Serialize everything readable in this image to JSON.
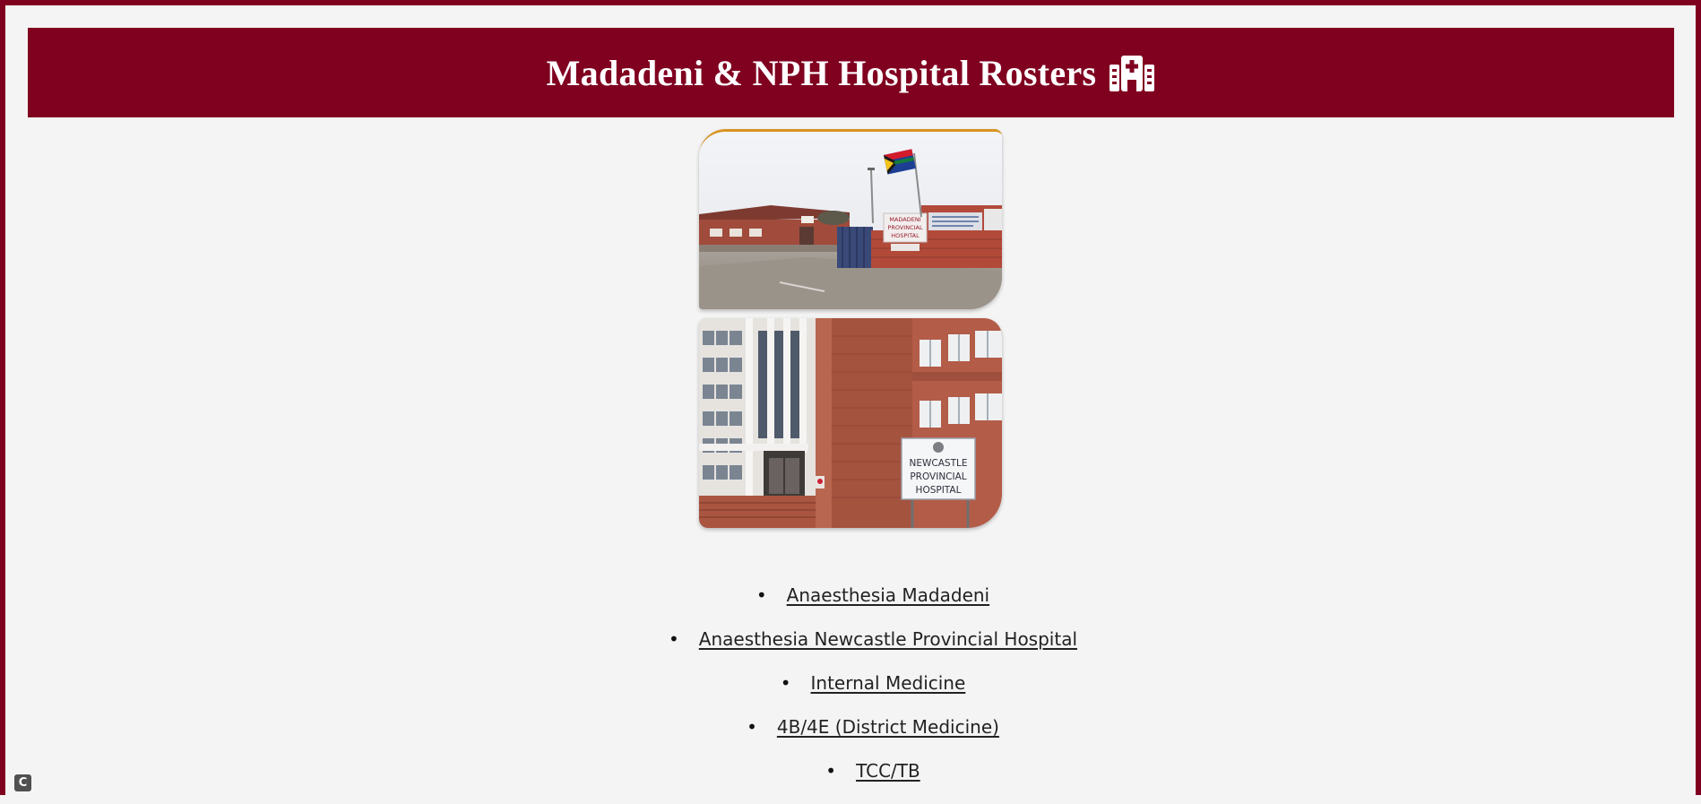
{
  "header": {
    "title": "Madadeni & NPH Hospital Rosters",
    "icon": "hospital-icon"
  },
  "photos": [
    {
      "name": "madadeni-hospital-photo",
      "sign_lines": [
        "MADADENI",
        "PROVINCIAL",
        "HOSPITAL"
      ]
    },
    {
      "name": "newcastle-hospital-photo",
      "sign_lines": [
        "NEWCASTLE",
        "PROVINCIAL",
        "HOSPITAL"
      ]
    }
  ],
  "links": [
    {
      "label": "Anaesthesia Madadeni"
    },
    {
      "label": "Anaesthesia Newcastle Provincial Hospital"
    },
    {
      "label": "Internal Medicine"
    },
    {
      "label": "4B/4E (District Medicine)"
    },
    {
      "label": "TCC/TB"
    }
  ],
  "bullet_glyph": "•",
  "corner_badge": "C",
  "colors": {
    "brand": "#800020",
    "background": "#f4f4f4",
    "link": "#222222"
  }
}
